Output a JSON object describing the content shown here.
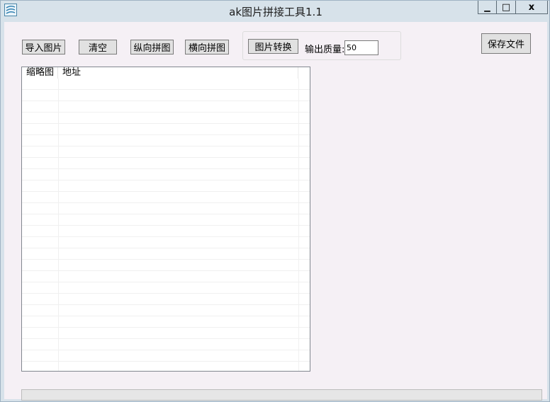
{
  "window": {
    "title": "ak图片拼接工具1.1",
    "icon": "app-icon",
    "controls": {
      "minimize": "▁",
      "maximize": "□",
      "close": "x"
    }
  },
  "toolbar": {
    "import_label": "导入图片",
    "clear_label": "清空",
    "vertical_label": "纵向拼图",
    "horizontal_label": "横向拼图",
    "convert_label": "图片转换",
    "quality_label": "输出质量:",
    "quality_value": "50",
    "save_label": "保存文件"
  },
  "list": {
    "columns": [
      "缩略图",
      "地址"
    ],
    "rows": []
  },
  "progress": {
    "value": 0
  }
}
